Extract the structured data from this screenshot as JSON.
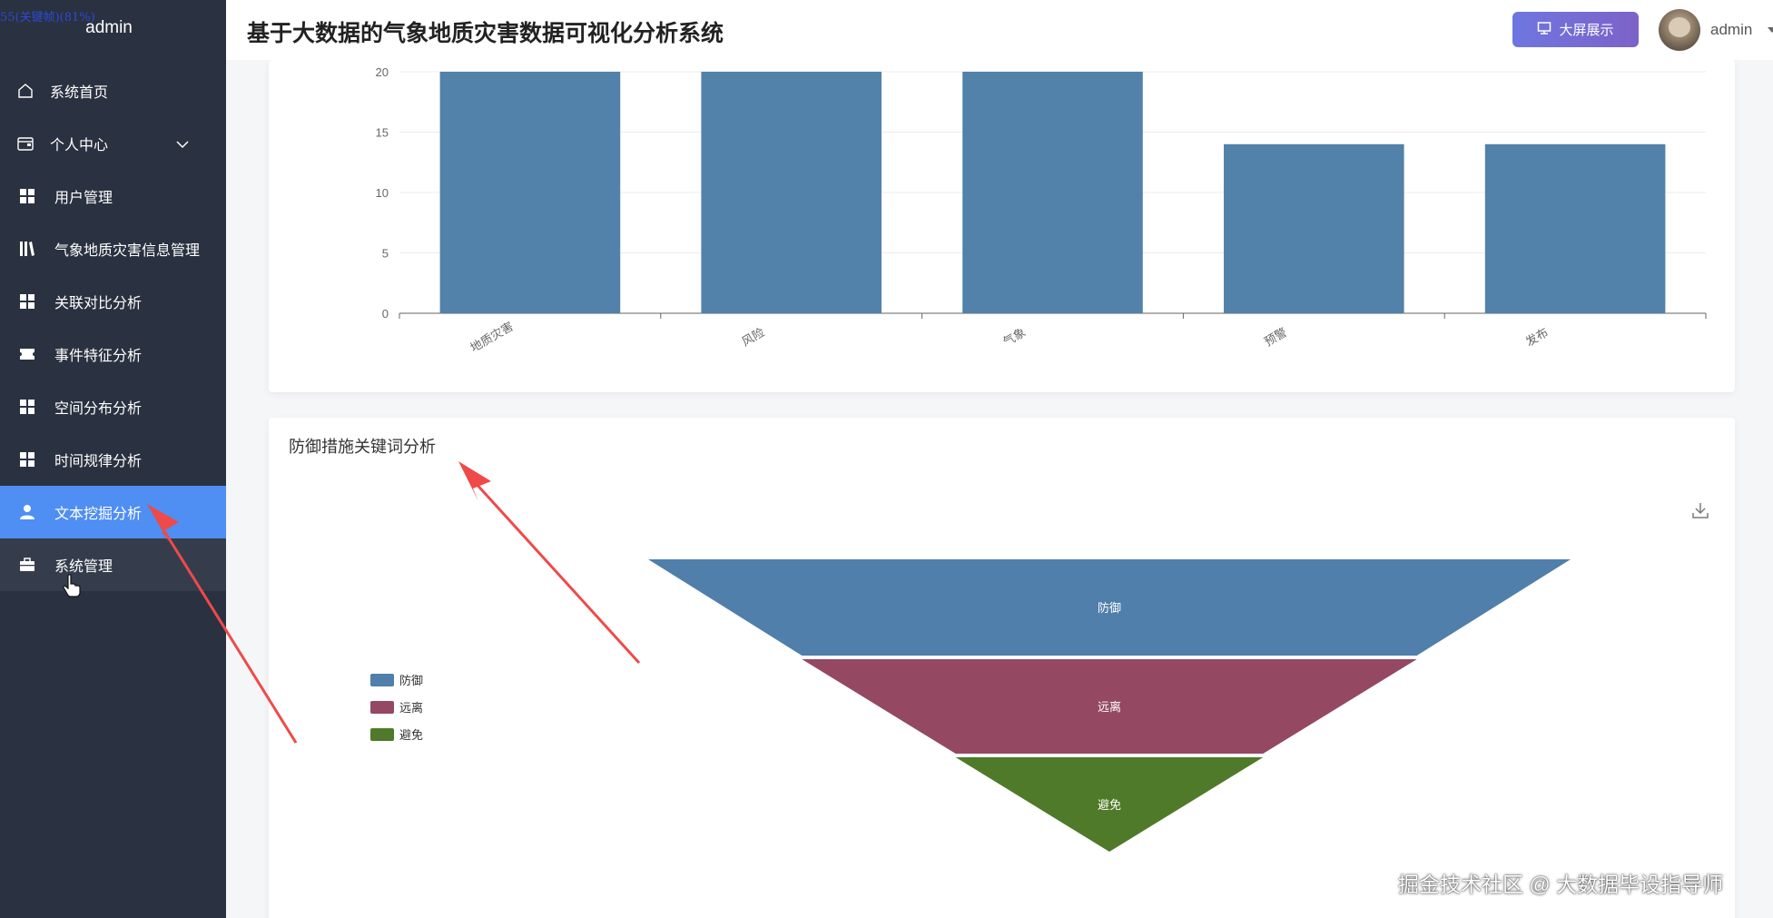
{
  "sidebar": {
    "overlay_text": "55(关键帧)(81%)",
    "title": "admin",
    "items": [
      {
        "label": "系统首页",
        "icon": "home-icon"
      },
      {
        "label": "个人中心",
        "icon": "wallet-icon"
      },
      {
        "label": "用户管理",
        "icon": "grid-icon"
      },
      {
        "label": "气象地质灾害信息管理",
        "icon": "library-icon"
      },
      {
        "label": "关联对比分析",
        "icon": "grid-icon"
      },
      {
        "label": "事件特征分析",
        "icon": "ticket-icon"
      },
      {
        "label": "空间分布分析",
        "icon": "grid-icon"
      },
      {
        "label": "时间规律分析",
        "icon": "grid-icon"
      },
      {
        "label": "文本挖掘分析",
        "icon": "user-icon"
      },
      {
        "label": "系统管理",
        "icon": "briefcase-icon"
      }
    ],
    "active_item": "文本挖掘分析"
  },
  "header": {
    "title": "基于大数据的气象地质灾害数据可视化分析系统",
    "big_screen_button": "大屏展示",
    "user": "admin"
  },
  "chart_data": [
    {
      "type": "bar",
      "categories": [
        "地质灾害",
        "风险",
        "气象",
        "预警",
        "发布"
      ],
      "values": [
        20,
        20,
        20,
        14,
        14
      ],
      "yticks": [
        "0",
        "5",
        "10",
        "15",
        "20"
      ],
      "ylim": [
        0,
        20
      ],
      "bar_color": "#5281a9"
    },
    {
      "type": "funnel",
      "title": "防御措施关键词分析",
      "categories": [
        "防御",
        "远离",
        "避免"
      ],
      "legend": [
        "防御",
        "远离",
        "避免"
      ],
      "colors": [
        "#4f7faa",
        "#944862",
        "#4f7a29"
      ],
      "legend_position": "left"
    }
  ],
  "watermark": "掘金技术社区 @ 大数据毕设指导师"
}
